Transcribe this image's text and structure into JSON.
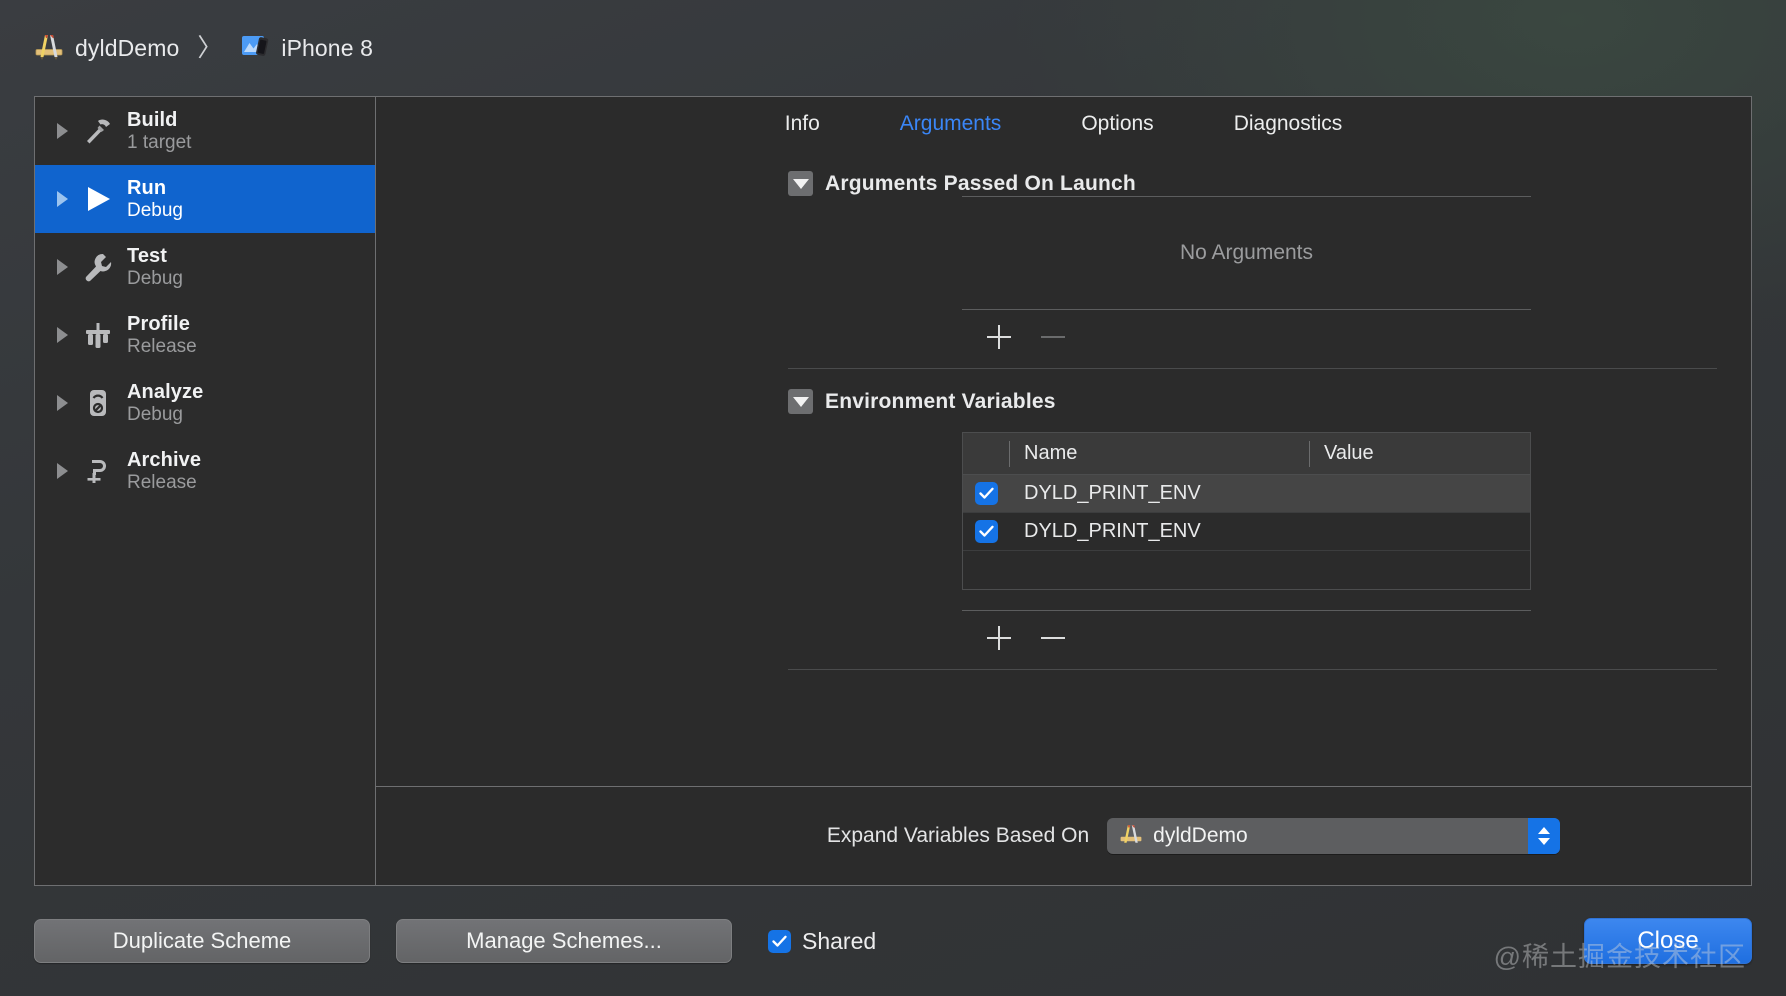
{
  "window": {
    "breadcrumb": {
      "scheme": "dyldDemo",
      "separator": "〉",
      "destination": "iPhone 8"
    }
  },
  "sidebar": {
    "items": [
      {
        "name": "Build",
        "sub": "1 target",
        "icon": "hammer-icon",
        "selected": false
      },
      {
        "name": "Run",
        "sub": "Debug",
        "icon": "play-icon",
        "selected": true
      },
      {
        "name": "Test",
        "sub": "Debug",
        "icon": "wrench-icon",
        "selected": false
      },
      {
        "name": "Profile",
        "sub": "Release",
        "icon": "gauge-icon",
        "selected": false
      },
      {
        "name": "Analyze",
        "sub": "Debug",
        "icon": "analyze-icon",
        "selected": false
      },
      {
        "name": "Archive",
        "sub": "Release",
        "icon": "clamp-icon",
        "selected": false
      }
    ]
  },
  "tabs": [
    {
      "label": "Info",
      "active": false
    },
    {
      "label": "Arguments",
      "active": true
    },
    {
      "label": "Options",
      "active": false
    },
    {
      "label": "Diagnostics",
      "active": false
    }
  ],
  "arguments_section": {
    "title": "Arguments Passed On Launch",
    "expanded": true,
    "empty_message": "No Arguments",
    "add_label": "+",
    "remove_label": "−",
    "remove_enabled": false
  },
  "environment_section": {
    "title": "Environment Variables",
    "expanded": true,
    "columns": [
      "Name",
      "Value"
    ],
    "rows": [
      {
        "checked": true,
        "name": "DYLD_PRINT_ENV",
        "value": "",
        "highlighted": true
      },
      {
        "checked": true,
        "name": "DYLD_PRINT_ENV",
        "value": "",
        "highlighted": false
      }
    ],
    "add_label": "+",
    "remove_label": "−",
    "remove_enabled": true
  },
  "expand_variables": {
    "label": "Expand Variables Based On",
    "selected": "dyldDemo",
    "icon": "xcode-app-icon"
  },
  "footer": {
    "duplicate_scheme": "Duplicate Scheme",
    "manage_schemes": "Manage Schemes...",
    "shared_label": "Shared",
    "shared_checked": true,
    "close": "Close"
  },
  "watermark": "@稀土掘金技术社区",
  "colors": {
    "accent_blue": "#1573e6",
    "selection_blue": "#1064ce",
    "tab_active": "#3a86f7",
    "panel_bg": "#2b2b2b",
    "sidebar_bg": "#2c2c2c"
  }
}
